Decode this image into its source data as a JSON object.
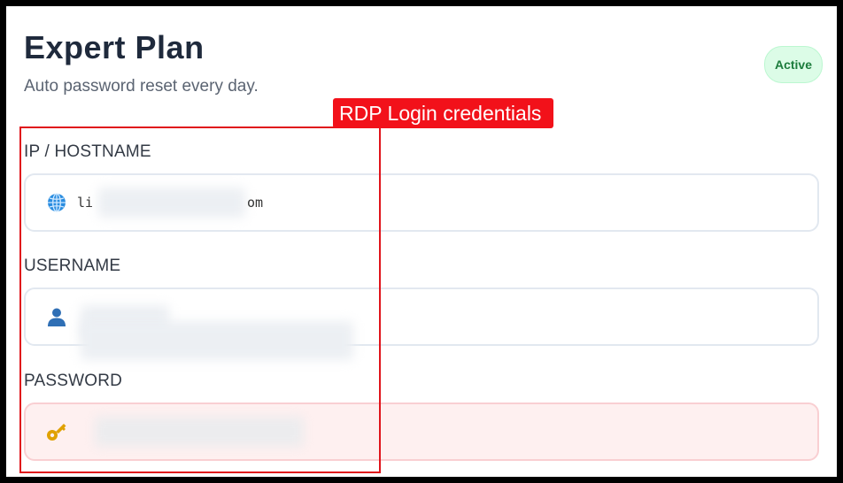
{
  "plan": {
    "title": "Expert Plan",
    "subtitle": "Auto password reset every day.",
    "status": "Active"
  },
  "annotation": {
    "label": "RDP Login credentials"
  },
  "fields": {
    "hostname": {
      "label": "IP / HOSTNAME",
      "icon": "globe-icon",
      "value_prefix": "li",
      "value_suffix": "om",
      "redacted": true
    },
    "username": {
      "label": "USERNAME",
      "icon": "user-icon",
      "redacted": true
    },
    "password": {
      "label": "PASSWORD",
      "icon": "key-icon",
      "redacted": true
    }
  },
  "colors": {
    "annotation": "#f2111a",
    "badge_bg": "#dcfce7",
    "badge_text": "#1c7c3c",
    "password_bg": "#fef0f0"
  }
}
